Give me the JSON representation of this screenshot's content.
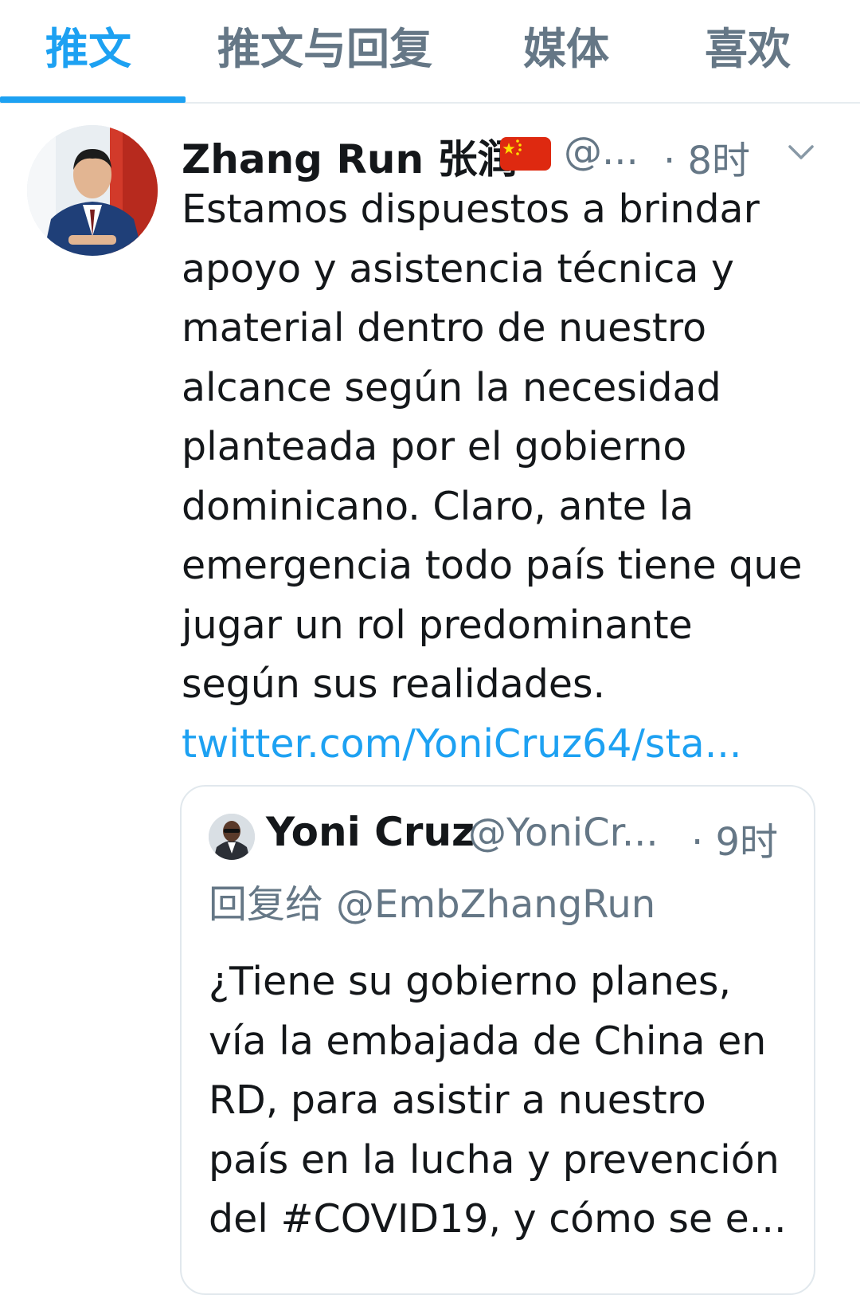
{
  "tabs": [
    {
      "label": "推文",
      "active": true
    },
    {
      "label": "推文与回复",
      "active": false
    },
    {
      "label": "媒体",
      "active": false
    },
    {
      "label": "喜欢",
      "active": false
    }
  ],
  "tweet": {
    "author_name": "Zhang Run 张润",
    "flag_icon": "china-flag",
    "handle": "@...",
    "time": "· 8时",
    "text_lines": [
      "Estamos dispuestos a brindar",
      "apoyo y asistencia técnica y",
      "material dentro de nuestro",
      "alcance según la necesidad",
      "planteada por el gobierno",
      "dominicano. Claro, ante la",
      "emergencia todo país tiene que",
      "jugar un rol predominante",
      "según sus realidades."
    ],
    "link": "twitter.com/YoniCruz64/sta..."
  },
  "quoted_tweet": {
    "author_name": "Yoni Cruz",
    "handle": "@YoniCr...",
    "time": "· 9时",
    "reply_prefix": "回复给",
    "reply_to": "@EmbZhangRun",
    "text_lines": [
      "¿Tiene su gobierno planes,",
      "vía la embajada de China en",
      "RD, para asistir a nuestro",
      "país en la lucha y prevención",
      "del #COVID19, y cómo se e..."
    ]
  },
  "colors": {
    "accent": "#1da1f2",
    "secondary_text": "#657786",
    "primary_text": "#14171a",
    "border": "#e1e8ed",
    "flag_red": "#de2910",
    "flag_yellow": "#ffde00"
  }
}
